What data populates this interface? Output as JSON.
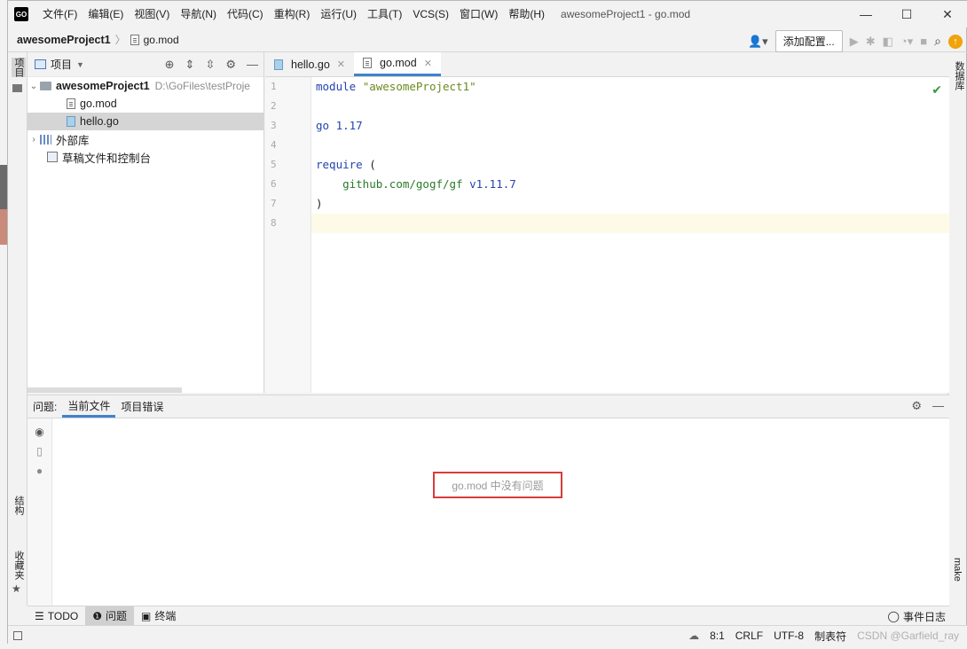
{
  "app": {
    "logo_text": "GO",
    "menu": [
      "文件(F)",
      "编辑(E)",
      "视图(V)",
      "导航(N)",
      "代码(C)",
      "重构(R)",
      "运行(U)",
      "工具(T)",
      "VCS(S)",
      "窗口(W)",
      "帮助(H)"
    ],
    "window_title": "awesomeProject1 - go.mod",
    "controls": {
      "minimize": "—",
      "maximize": "☐",
      "close": "✕"
    }
  },
  "navbar": {
    "project": "awesomeProject1",
    "file": "go.mod",
    "add_config_label": "添加配置..."
  },
  "left_strip": {
    "project_label": "项目",
    "structure_label": "结构",
    "favorites_label": "收藏夹"
  },
  "right_strip": {
    "database_label": "数据库",
    "make_label": "make"
  },
  "project_panel": {
    "title": "项目",
    "tree": {
      "root_name": "awesomeProject1",
      "root_path": "D:\\GoFiles\\testProje",
      "files": [
        "go.mod",
        "hello.go"
      ],
      "external_libs": "外部库",
      "scratches": "草稿文件和控制台"
    }
  },
  "editor": {
    "tabs": [
      "hello.go",
      "go.mod"
    ],
    "active_tab": "go.mod",
    "line_numbers": [
      "1",
      "2",
      "3",
      "4",
      "5",
      "6",
      "7",
      "8"
    ],
    "code": {
      "l1_kw": "module",
      "l1_str": "\"awesomeProject1\"",
      "l3_kw": "go",
      "l3_ver": "1.17",
      "l5_kw": "require",
      "l5_paren": "(",
      "l6_pkg": "github.com/gogf/gf",
      "l6_ver": "v1.11.7",
      "l7_paren": ")"
    }
  },
  "problems": {
    "label": "问题:",
    "tabs": [
      "当前文件",
      "项目错误"
    ],
    "active_tab": "当前文件",
    "empty_message": "go.mod 中没有问题"
  },
  "bottom_tools": {
    "todo": "TODO",
    "problems": "问题",
    "terminal": "终端",
    "event_log": "事件日志"
  },
  "status": {
    "position": "8:1",
    "line_sep": "CRLF",
    "encoding": "UTF-8",
    "indent": "制表符",
    "watermark": "CSDN @Garfield_ray"
  },
  "colors": {
    "accent": "#4083c9",
    "highlight_box": "#d93c3c",
    "keyword": "#2244b0",
    "string": "#6b8a1f"
  }
}
